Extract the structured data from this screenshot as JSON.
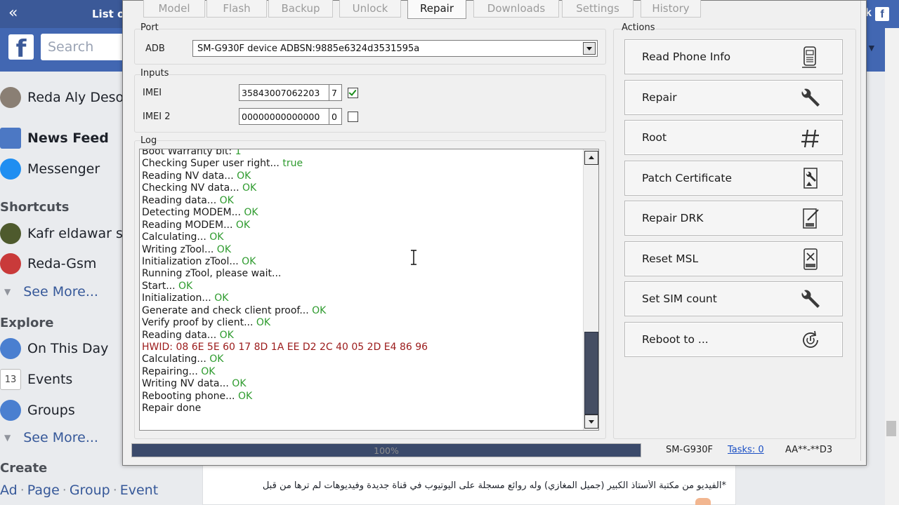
{
  "facebook": {
    "tab_title": "List of",
    "logo_letter": "f",
    "search_placeholder": "Search",
    "right_tab_letter": "k",
    "right_fb_letter": "f",
    "profile_name": "Reda Aly Desok",
    "news_feed": "News Feed",
    "messenger": "Messenger",
    "shortcuts_header": "Shortcuts",
    "shortcuts": [
      "Kafr eldawar sto",
      "Reda-Gsm"
    ],
    "see_more_1": "See More...",
    "explore_header": "Explore",
    "explore": [
      "On This Day",
      "Events",
      "Groups"
    ],
    "events_day": "13",
    "see_more_2": "See More...",
    "create_header": "Create",
    "create_links": [
      "Ad",
      "Page",
      "Group",
      "Event"
    ],
    "create_sep": "·",
    "post_text": "*الفيديو من مكتبة الأستاذ الكبير (جميل المغازي) وله روائع مسجلة على اليوتيوب في قناة جديدة وفيديوهات لم ترها من قبل"
  },
  "ztool": {
    "tabs": [
      {
        "label": "Model",
        "active": false
      },
      {
        "label": "Flash",
        "active": false
      },
      {
        "label": "Backup",
        "active": false
      },
      {
        "label": "Unlock",
        "active": false
      },
      {
        "label": "Repair",
        "active": true
      },
      {
        "label": "Downloads",
        "active": false
      },
      {
        "label": "Settings",
        "active": false
      },
      {
        "label": "History",
        "active": false
      }
    ],
    "port": {
      "group_title": "Port",
      "label": "ADB",
      "selected": "SM-G930F device ADBSN:9885e6324d3531595a"
    },
    "inputs": {
      "group_title": "Inputs",
      "imei_label": "IMEI",
      "imei_value": "35843007062203",
      "imei_check_digit": "7",
      "imei_checked": true,
      "imei2_label": "IMEI 2",
      "imei2_value": "00000000000000",
      "imei2_check_digit": "0",
      "imei2_checked": false
    },
    "log": {
      "group_title": "Log",
      "lines": [
        {
          "text": "Boot Warranty bit: ",
          "status": "1"
        },
        {
          "text": "Checking Super user right... ",
          "status": "true"
        },
        {
          "text": "Reading NV data... ",
          "status": "OK"
        },
        {
          "text": "Checking NV data... ",
          "status": "OK"
        },
        {
          "text": "Reading data... ",
          "status": "OK"
        },
        {
          "text": "Detecting MODEM... ",
          "status": "OK"
        },
        {
          "text": "Reading MODEM... ",
          "status": "OK"
        },
        {
          "text": "Calculating... ",
          "status": "OK"
        },
        {
          "text": "Writing zTool... ",
          "status": "OK"
        },
        {
          "text": "Initialization zTool... ",
          "status": "OK"
        },
        {
          "text": "Running zTool, please wait...",
          "status": ""
        },
        {
          "text": "Start... ",
          "status": "OK"
        },
        {
          "text": "Initialization... ",
          "status": "OK"
        },
        {
          "text": "Generate and check client proof... ",
          "status": "OK"
        },
        {
          "text": "Verify proof by client... ",
          "status": "OK"
        },
        {
          "text": "Reading data... ",
          "status": "OK"
        },
        {
          "text": "HWID:  08 6E 5E 60 17 8D 1A EE D2 2C 40 05 2D E4 86 96",
          "status": "",
          "kind": "hwid"
        },
        {
          "text": "Calculating... ",
          "status": "OK"
        },
        {
          "text": "Repairing... ",
          "status": "OK"
        },
        {
          "text": "Writing NV data... ",
          "status": "OK"
        },
        {
          "text": "Rebooting phone... ",
          "status": "OK"
        },
        {
          "text": "Repair done",
          "status": ""
        }
      ]
    },
    "actions": {
      "group_title": "Actions",
      "buttons": [
        {
          "label": "Read Phone Info",
          "icon": "phone-info-icon"
        },
        {
          "label": "Repair",
          "icon": "wrench-icon"
        },
        {
          "label": "Root",
          "icon": "hash-icon"
        },
        {
          "label": "Patch Certificate",
          "icon": "certificate-icon"
        },
        {
          "label": "Repair DRK",
          "icon": "drk-icon"
        },
        {
          "label": "Reset MSL",
          "icon": "msl-icon"
        },
        {
          "label": "Set SIM count",
          "icon": "wrench-icon"
        },
        {
          "label": "Reboot to ...",
          "icon": "reboot-icon"
        }
      ]
    },
    "statusbar": {
      "progress_percent": 100,
      "progress_label": "100%",
      "model": "SM-G930F",
      "tasks": "Tasks: 0",
      "serial_mask": "AA**-**D3"
    }
  }
}
